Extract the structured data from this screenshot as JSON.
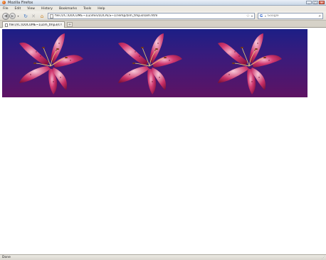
{
  "window": {
    "title": "Mozilla Firefox",
    "controls": [
      "_",
      "□",
      "×"
    ]
  },
  "menu": [
    "File",
    "Edit",
    "View",
    "History",
    "Bookmarks",
    "Tools",
    "Help"
  ],
  "navigation": {
    "back_glyph": "◀",
    "forward_glyph": "▶",
    "dropdown_glyph": "▾",
    "reload_glyph": "↻",
    "stop_glyph": "✕",
    "home_glyph": "⌂",
    "url": "file:///C:/DOCUME~1/Zimin/LOCALS~1/Temp/zim_tmp3/sam.htm",
    "star_glyph": "☆",
    "url_dropdown_glyph": "▾"
  },
  "search": {
    "engine_glyph": "G",
    "engine_dropdown_glyph": "▾",
    "placeholder": "Google",
    "magnifier_glyph": "⌕"
  },
  "tabs": [
    {
      "title": "file:///C:/DOCUME~1/Zim_tmp3/sam.htm",
      "close_glyph": "×"
    }
  ],
  "new_tab_glyph": "+",
  "page": {
    "banner": {
      "background_top": "#1c1f86",
      "background_bottom": "#5e1363",
      "images": [
        "lily-flower",
        "lily-flower",
        "lily-flower"
      ]
    }
  },
  "statusbar": {
    "status": "Done",
    "grip_glyph": "⋰"
  }
}
